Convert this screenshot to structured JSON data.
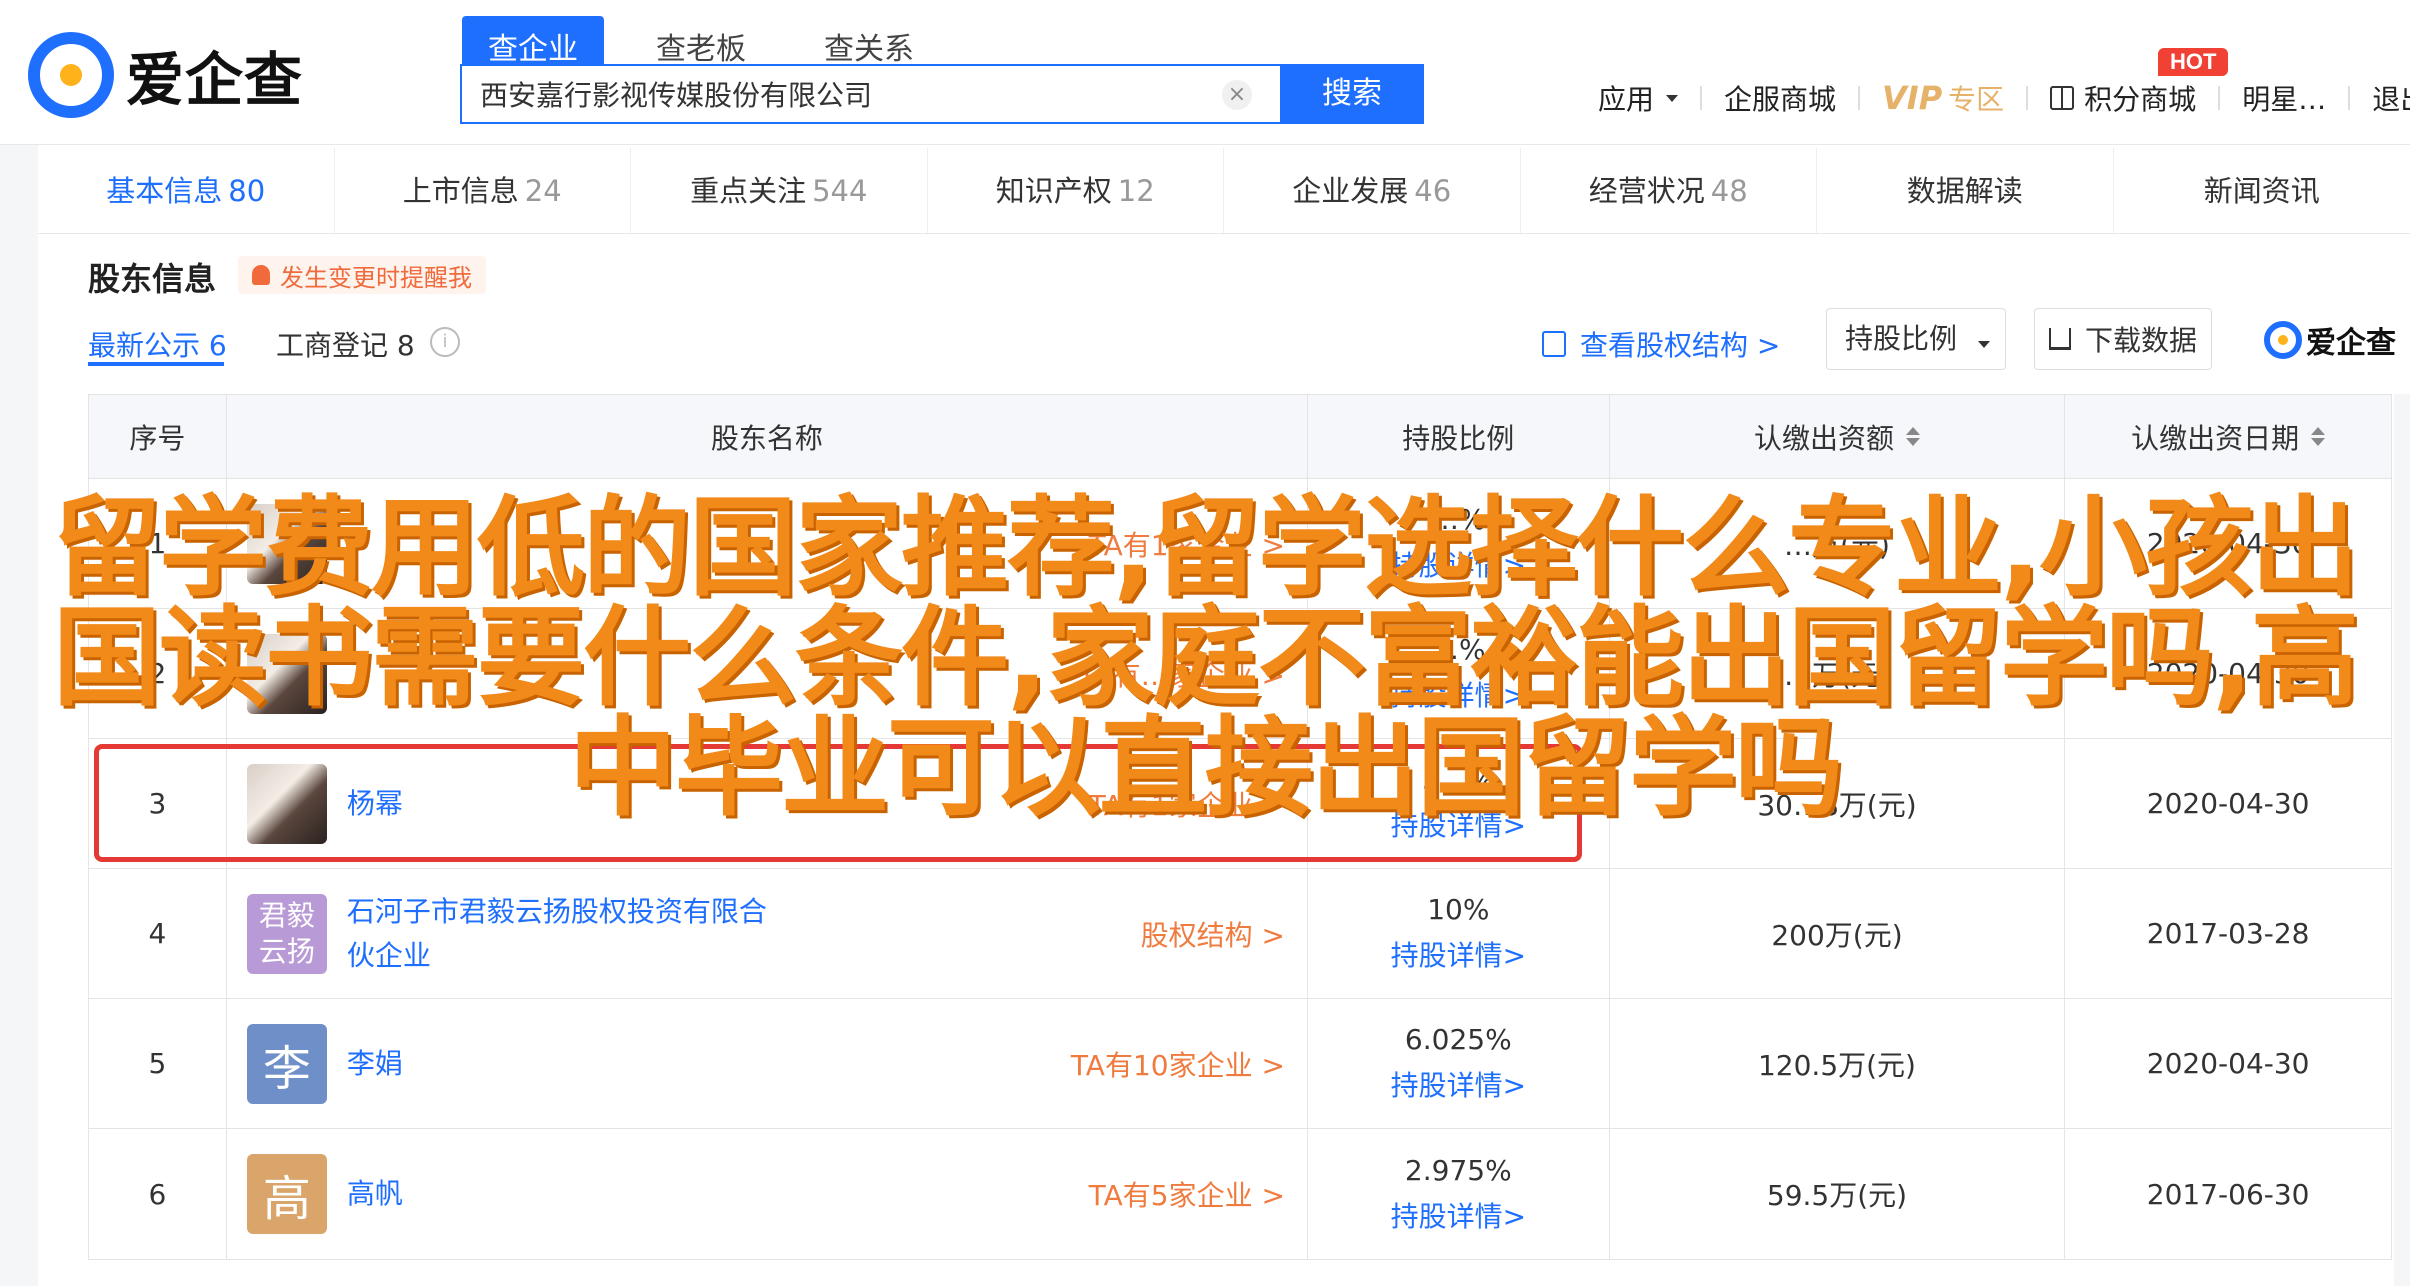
{
  "app": {
    "logo_text": "爱企查"
  },
  "search": {
    "tabs": [
      "查企业",
      "查老板",
      "查关系"
    ],
    "value": "西安嘉行影视传媒股份有限公司",
    "button": "搜索",
    "clear": "×"
  },
  "topnav": {
    "apps": "应用",
    "mall": "企服商城",
    "vip": "VIP",
    "vip_sub": "专区",
    "points": "积分商城",
    "hot": "HOT",
    "partial1": "明星…",
    "partial2": "退出"
  },
  "section_tabs": [
    {
      "label": "基本信息",
      "count": "80"
    },
    {
      "label": "上市信息",
      "count": "24"
    },
    {
      "label": "重点关注",
      "count": "544"
    },
    {
      "label": "知识产权",
      "count": "12"
    },
    {
      "label": "企业发展",
      "count": "46"
    },
    {
      "label": "经营状况",
      "count": "48"
    },
    {
      "label": "数据解读",
      "count": ""
    },
    {
      "label": "新闻资讯",
      "count": ""
    }
  ],
  "shareholders": {
    "title": "股东信息",
    "alert": "发生变更时提醒我",
    "sub_tab_latest": "最新公示 6",
    "sub_tab_registry": "工商登记 8",
    "info_icon": "i",
    "view_structure": "查看股权结构 >",
    "ratio_select": "持股比例",
    "download": "下载数据",
    "mini_logo": "爱企查"
  },
  "table": {
    "headers": [
      "序号",
      "股东名称",
      "持股比例",
      "认缴出资额",
      "认缴出资日期"
    ],
    "rows": [
      {
        "no": "1",
        "avatar": "",
        "name": "",
        "link": "TA有1家企业 >",
        "ratio": "…%",
        "detail": "持股详情>",
        "amount": "…万(元)",
        "date": "2020-04-30"
      },
      {
        "no": "2",
        "avatar": "",
        "name": "",
        "link": "TA有…家企业 >",
        "ratio": "…%",
        "detail": "持股详情>",
        "amount": "…万(元)",
        "date": "2020-04-30"
      },
      {
        "no": "3",
        "avatar": "",
        "name": "杨幂",
        "link": "TA有1家企业 >",
        "ratio": "5…%",
        "detail": "持股详情>",
        "amount": "30…8万(元)",
        "date": "2020-04-30"
      },
      {
        "no": "4",
        "avatar": "君毅云扬",
        "name": "石河子市君毅云扬股权投资有限合伙企业",
        "link": "股权结构 >",
        "ratio": "10%",
        "detail": "持股详情>",
        "amount": "200万(元)",
        "date": "2017-03-28"
      },
      {
        "no": "5",
        "avatar": "李",
        "name": "李娟",
        "link": "TA有10家企业 >",
        "ratio": "6.025%",
        "detail": "持股详情>",
        "amount": "120.5万(元)",
        "date": "2020-04-30"
      },
      {
        "no": "6",
        "avatar": "高",
        "name": "高帆",
        "link": "TA有5家企业 >",
        "ratio": "2.975%",
        "detail": "持股详情>",
        "amount": "59.5万(元)",
        "date": "2017-06-30"
      }
    ]
  },
  "overlay": {
    "line1": "留学费用低的国家推荐,留学选择什么专业,小孩出",
    "line2": "国读书需要什么条件,家庭不富裕能出国留学吗,高",
    "line3": "中毕业可以直接出国留学吗"
  },
  "colors": {
    "brand": "#1f6fff",
    "accent_orange": "#f07b3f",
    "overlay_orange": "#f28a1a",
    "highlight_red": "#e53935",
    "avatar_purple": "#b89ad6",
    "avatar_blue": "#6f8fc8",
    "avatar_tan": "#d9a56a"
  }
}
